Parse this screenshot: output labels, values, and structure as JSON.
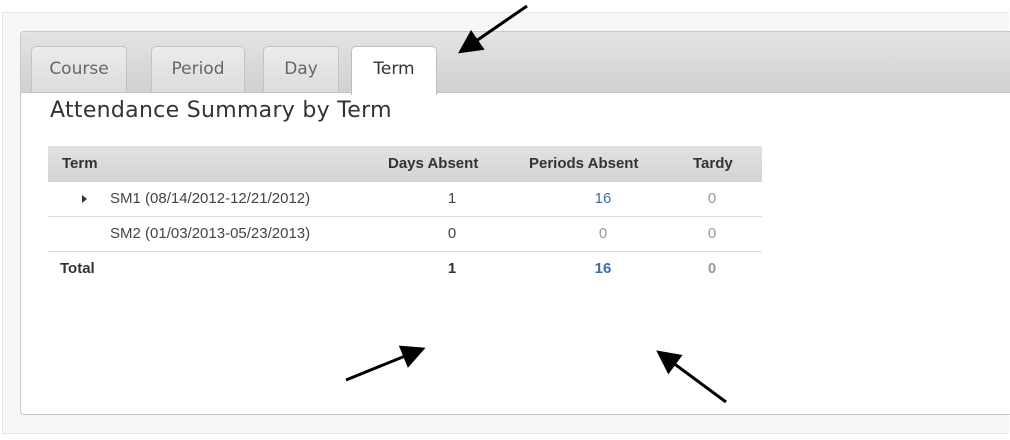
{
  "tabs": [
    {
      "label": "Course",
      "active": false
    },
    {
      "label": "Period",
      "active": false
    },
    {
      "label": "Day",
      "active": false
    },
    {
      "label": "Term",
      "active": true
    }
  ],
  "page_title": "Attendance Summary by Term",
  "table": {
    "columns": [
      "Term",
      "Days Absent",
      "Periods Absent",
      "Tardy"
    ],
    "rows": [
      {
        "term": "SM1 (08/14/2012-12/21/2012)",
        "days_absent": "1",
        "periods_absent": "16",
        "tardy": "0",
        "expandable": true
      },
      {
        "term": "SM2 (01/03/2013-05/23/2013)",
        "days_absent": "0",
        "periods_absent": "0",
        "tardy": "0",
        "expandable": false
      }
    ],
    "total": {
      "label": "Total",
      "days_absent": "1",
      "periods_absent": "16",
      "tardy": "0"
    }
  },
  "colors": {
    "link": "#3a6ea5",
    "muted": "#999999",
    "annotation_arrow": "#000000"
  }
}
